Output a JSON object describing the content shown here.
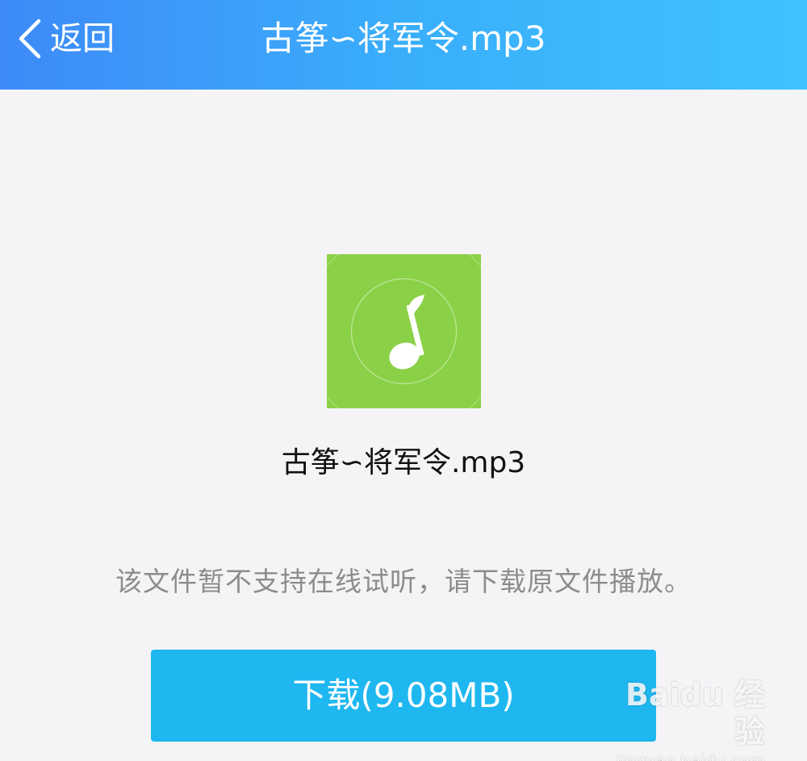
{
  "header": {
    "back_label": "返回",
    "title": "古筝∽将军令.mp3"
  },
  "file": {
    "icon": "music-note-icon",
    "icon_bg_color": "#8bd147",
    "name": "古筝∽将军令.mp3"
  },
  "notice": "该文件暂不支持在线试听，请下载原文件播放。",
  "download_button": {
    "label": "下载(9.08MB)",
    "color": "#1fb7f0"
  },
  "watermark": {
    "main": "Baidu 经验",
    "url": "jingyan.baidu.com"
  },
  "colors": {
    "header_gradient_start": "#3d8af7",
    "header_gradient_end": "#3ec2ff",
    "page_bg": "#f4f4f7",
    "notice_text": "#8c8c8c"
  }
}
